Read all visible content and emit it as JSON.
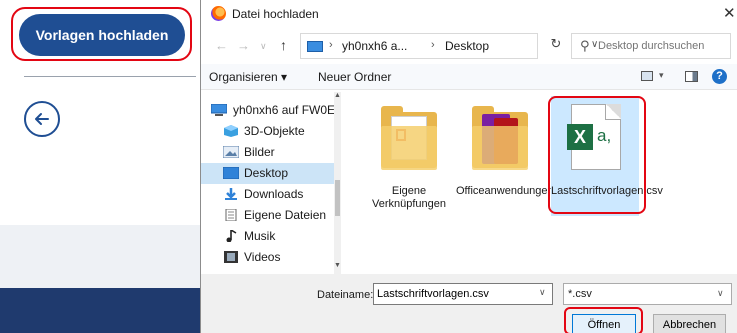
{
  "page": {
    "upload_button": "Vorlagen hochladen"
  },
  "dialog": {
    "title": "Datei hochladen",
    "close": "✕",
    "address": {
      "sep": "›",
      "crumbs": [
        "yh0nxh6 a...",
        "Desktop"
      ]
    },
    "search_placeholder": "Desktop durchsuchen",
    "toolbar": {
      "organize": "Organisieren ▾",
      "new_folder": "Neuer Ordner",
      "help": "?"
    },
    "nav_items": [
      {
        "label": "yh0nxh6 auf FW0E",
        "icon": "computer-icon"
      },
      {
        "label": "3D-Objekte",
        "icon": "cube-icon"
      },
      {
        "label": "Bilder",
        "icon": "pictures-icon"
      },
      {
        "label": "Desktop",
        "icon": "desktop-icon",
        "selected": true
      },
      {
        "label": "Downloads",
        "icon": "download-icon"
      },
      {
        "label": "Eigene Dateien",
        "icon": "documents-icon"
      },
      {
        "label": "Musik",
        "icon": "music-icon"
      },
      {
        "label": "Videos",
        "icon": "video-icon"
      }
    ],
    "files": [
      {
        "label": "Eigene Verknüpfungen",
        "icon": "folder-icon"
      },
      {
        "label": "Officeanwendungen",
        "icon": "folder-icon"
      },
      {
        "label": "Lastschriftvorlagen.csv",
        "icon": "excel-csv-icon",
        "selected": true
      }
    ],
    "filename_label": "Dateiname:",
    "filename_value": "Lastschriftvorlagen.csv",
    "filetype_value": "*.csv",
    "open_button": "Öffnen",
    "cancel_button": "Abbrechen"
  },
  "colors": {
    "primary": "#1f4e93",
    "highlight": "#e30613",
    "footer": "#1f3a6e",
    "selection": "#cce8ff"
  }
}
